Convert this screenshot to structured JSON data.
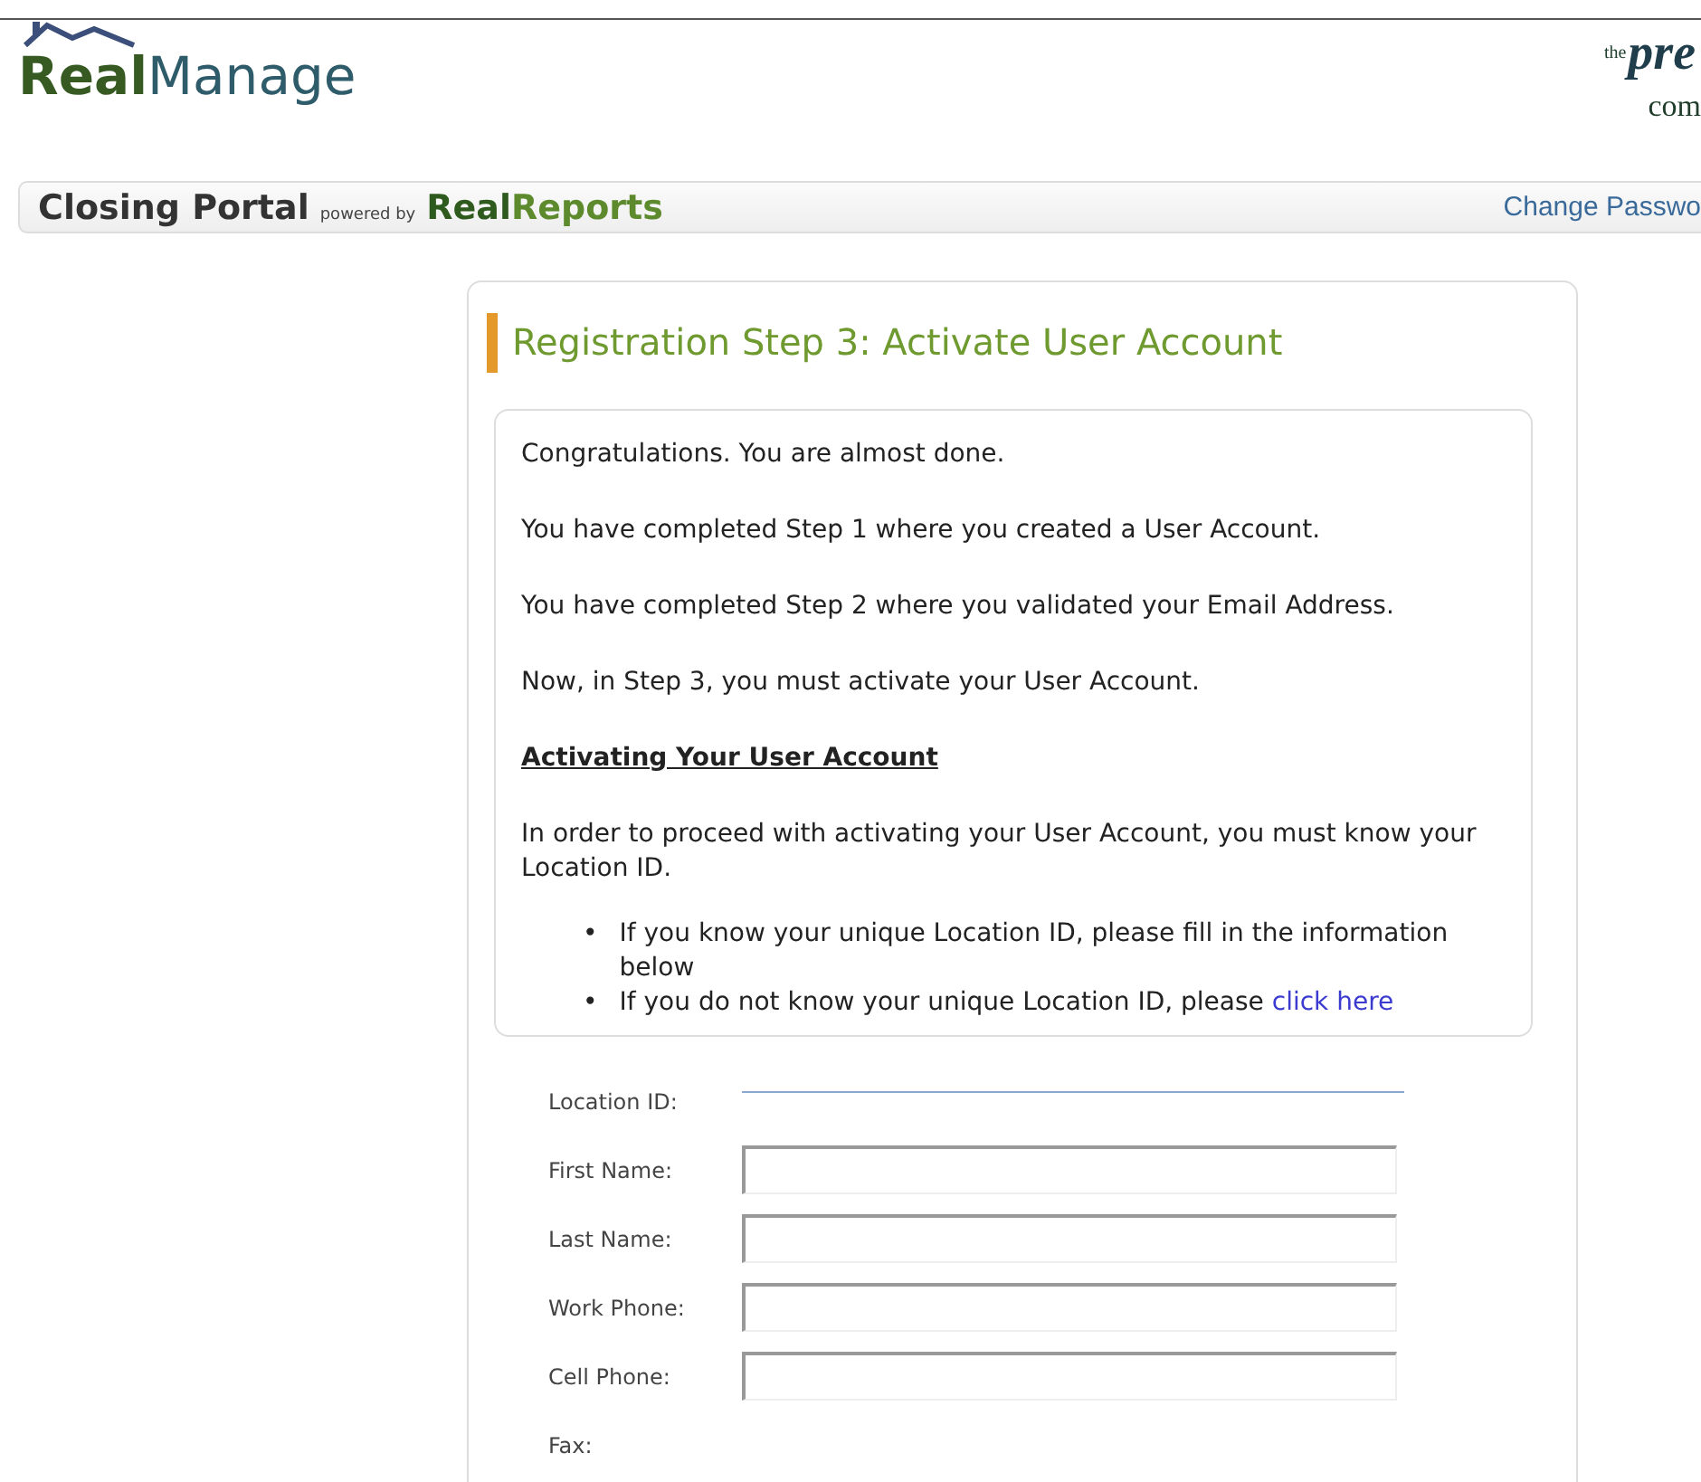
{
  "header": {
    "logo": {
      "bold": "Real",
      "rest": "Manage"
    },
    "partner_logo": {
      "small": "the",
      "large": "pre",
      "line2": "com"
    }
  },
  "nav": {
    "title": "Closing Portal",
    "powered_by": "powered by",
    "brand_bold": "Real",
    "brand_rest": "Reports",
    "link": "Change Passwo"
  },
  "card": {
    "title": "Registration Step 3: Activate User Account",
    "paragraphs": [
      {
        "kind": "text",
        "text": "Congratulations. You are almost done."
      },
      {
        "kind": "text",
        "text": "You have completed Step 1 where you created a User Account."
      },
      {
        "kind": "text",
        "text": "You have completed Step 2 where you validated your Email Address."
      },
      {
        "kind": "text",
        "text": "Now, in Step 3, you must activate your User Account."
      },
      {
        "kind": "heading",
        "text": "Activating Your User Account"
      },
      {
        "kind": "text",
        "text": "In order to proceed with activating your User Account, you must know your Location ID."
      }
    ],
    "bullets": [
      {
        "marker": "•",
        "text": "If you know your unique Location ID, please fill in the information below"
      },
      {
        "marker": "•",
        "text": "If you do not know your unique Location ID, please ",
        "link": "click here"
      }
    ]
  },
  "form": {
    "fields": [
      {
        "label": "Location ID:",
        "kind": "underline"
      },
      {
        "label": "First Name:",
        "kind": "box"
      },
      {
        "label": "Last Name:",
        "kind": "box"
      },
      {
        "label": "Work Phone:",
        "kind": "box"
      },
      {
        "label": "Cell Phone:",
        "kind": "box"
      },
      {
        "label": "Fax:",
        "kind": "none"
      }
    ]
  }
}
